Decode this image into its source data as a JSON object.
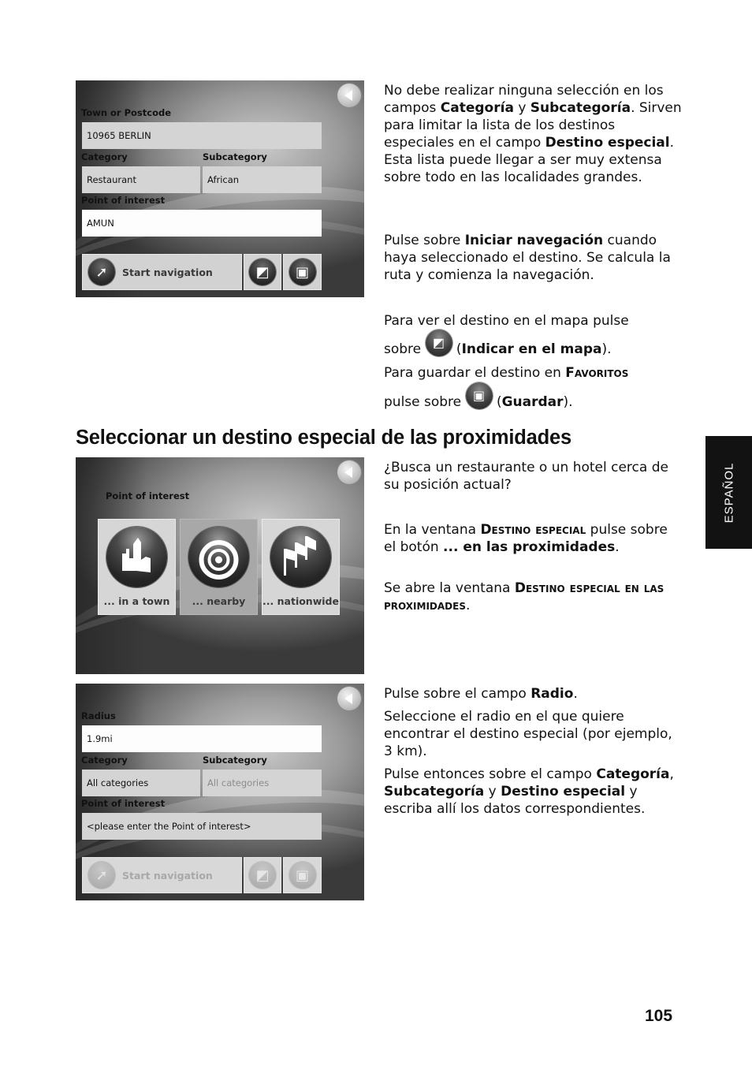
{
  "page": {
    "number": "105",
    "side_tab": "ESPAÑOL",
    "section_heading": "Seleccionar un destino especial de las proximidades"
  },
  "screen1": {
    "town_label": "Town or Postcode",
    "town_value": "10965 BERLIN",
    "category_label": "Category",
    "category_value": "Restaurant",
    "subcategory_label": "Subcategory",
    "subcategory_value": "African",
    "poi_label": "Point of interest",
    "poi_value": "AMUN",
    "start_nav_label": "Start navigation",
    "icons": {
      "back": "back-arrow-icon",
      "start": "navigation-arrow-icon",
      "map": "map-icon",
      "save": "floppy-disk-icon"
    }
  },
  "screen2": {
    "title_label": "Point of interest",
    "options": [
      {
        "label": "... in a town",
        "icon": "city-icon",
        "selected": false
      },
      {
        "label": "... nearby",
        "icon": "target-icon",
        "selected": true
      },
      {
        "label": "... nationwide",
        "icon": "flags-icon",
        "selected": false
      }
    ]
  },
  "screen3": {
    "radius_label": "Radius",
    "radius_value": "1.9mi",
    "category_label": "Category",
    "category_value": "All categories",
    "subcategory_label": "Subcategory",
    "subcategory_value": "All categories",
    "poi_label": "Point of interest",
    "poi_placeholder": "<please enter the Point of interest>",
    "start_nav_label": "Start navigation"
  },
  "text": {
    "p1": {
      "t1": "No debe realizar ninguna selección en los campos ",
      "b1": "Categoría",
      "t2": " y ",
      "b2": "Subcategoría",
      "t3": ". Sirven para limitar la lista de los destinos especiales en el campo ",
      "b3": "Destino especial",
      "t4": ". Esta lista puede llegar a ser muy extensa sobre todo en las localidades grandes."
    },
    "p2": {
      "t1": "Pulse sobre ",
      "b1": "Iniciar navegación",
      "t2": " cuando haya seleccionado el destino. Se calcula la ruta y comienza la navegación."
    },
    "p3": {
      "t1": "Para ver el destino en el mapa pulse sobre ",
      "t2": " (",
      "b1": "Indicar en el mapa",
      "t3": ")."
    },
    "p4": {
      "t1": "Para guardar el destino en ",
      "sc1": "Favoritos",
      "t2": " pulse sobre ",
      "t3": " (",
      "b1": "Guardar",
      "t4": ")."
    },
    "p5": "¿Busca un restaurante o un hotel cerca de su posición actual?",
    "p6": {
      "t1": "En la ventana ",
      "sc1": "Destino especial",
      "t2": " pulse sobre el botón ",
      "b1": "... en las proximidades",
      "t3": "."
    },
    "p7": {
      "t1": "Se abre la ventana ",
      "sc1": "Destino especial en las proximidades",
      "t2": "."
    },
    "p8": {
      "t1": "Pulse sobre el campo ",
      "b1": "Radio",
      "t2": "."
    },
    "p9": "Seleccione el radio en el que quiere encontrar el destino especial (por ejemplo, 3 km).",
    "p10": {
      "t1": "Pulse entonces sobre el campo ",
      "b1": "Categoría",
      "t2": ", ",
      "b2": "Subcategoría",
      "t3": " y ",
      "b3": "Destino especial",
      "t4": " y escriba allí los datos correspondientes."
    }
  }
}
